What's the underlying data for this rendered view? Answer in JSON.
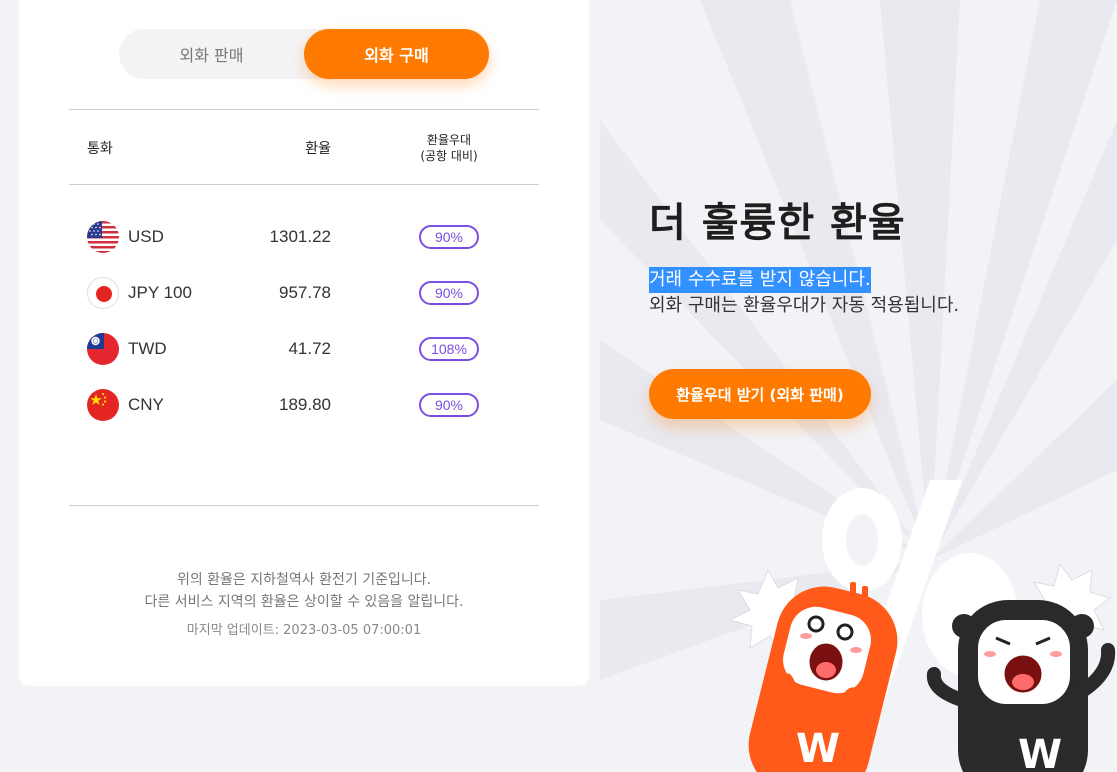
{
  "tabs": {
    "sell_label": "외화 판매",
    "buy_label": "외화 구매",
    "active": "buy"
  },
  "table": {
    "headers": {
      "currency": "통화",
      "rate": "환율",
      "preference_line1": "환율우대",
      "preference_line2": "(공항 대비)"
    },
    "rows": [
      {
        "code": "USD",
        "rate": "1301.22",
        "preference": "90%",
        "flag_icon": "us-flag-icon"
      },
      {
        "code": "JPY 100",
        "rate": "957.78",
        "preference": "90%",
        "flag_icon": "japan-flag-icon"
      },
      {
        "code": "TWD",
        "rate": "41.72",
        "preference": "108%",
        "flag_icon": "taiwan-flag-icon"
      },
      {
        "code": "CNY",
        "rate": "189.80",
        "preference": "90%",
        "flag_icon": "china-flag-icon"
      }
    ]
  },
  "notes": {
    "line1": "위의 환율은 지하철역사 환전기 기준입니다.",
    "line2": "다른 서비스 지역의 환율은 상이할 수 있음을 알립니다.",
    "updated": "마지막 업데이트: 2023-03-05 07:00:01"
  },
  "promo": {
    "title": "더 훌륭한 환율",
    "line1": "거래 수수료를 받지 않습니다.",
    "line2": "외화 구매는 환율우대가 자동 적용됩니다.",
    "cta_label": "환율우대 받기 (외화 판매)"
  },
  "colors": {
    "accent": "#ff7a00",
    "badge": "#7b4fe0",
    "highlight": "#3390ff",
    "background": "#f2f3f7"
  }
}
